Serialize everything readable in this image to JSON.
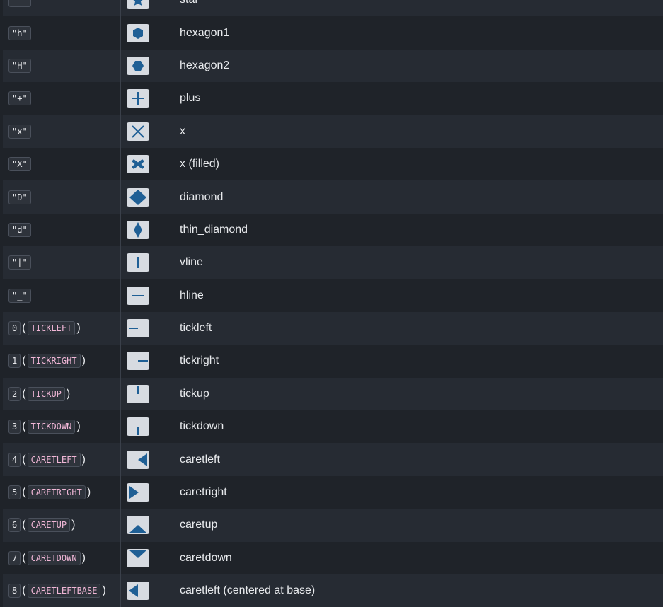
{
  "colors": {
    "marker": "#1f5f95",
    "swatch_bg": "#d7dbe1"
  },
  "rows": [
    {
      "code": "",
      "marker_icon": "star-icon",
      "description": "star"
    },
    {
      "code": "\"h\"",
      "marker_icon": "hexagon1-icon",
      "description": "hexagon1"
    },
    {
      "code": "\"H\"",
      "marker_icon": "hexagon2-icon",
      "description": "hexagon2"
    },
    {
      "code": "\"+\"",
      "marker_icon": "plus-icon",
      "description": "plus"
    },
    {
      "code": "\"x\"",
      "marker_icon": "x-icon",
      "description": "x"
    },
    {
      "code": "\"X\"",
      "marker_icon": "x-filled-icon",
      "description": "x (filled)"
    },
    {
      "code": "\"D\"",
      "marker_icon": "diamond-icon",
      "description": "diamond"
    },
    {
      "code": "\"d\"",
      "marker_icon": "thin-diamond-icon",
      "description": "thin_diamond"
    },
    {
      "code": "\"|\"",
      "marker_icon": "vline-icon",
      "description": "vline"
    },
    {
      "code": "\"_\"",
      "marker_icon": "hline-icon",
      "description": "hline"
    },
    {
      "code": "0",
      "constant": "TICKLEFT",
      "marker_icon": "tickleft-icon",
      "description": "tickleft"
    },
    {
      "code": "1",
      "constant": "TICKRIGHT",
      "marker_icon": "tickright-icon",
      "description": "tickright"
    },
    {
      "code": "2",
      "constant": "TICKUP",
      "marker_icon": "tickup-icon",
      "description": "tickup"
    },
    {
      "code": "3",
      "constant": "TICKDOWN",
      "marker_icon": "tickdown-icon",
      "description": "tickdown"
    },
    {
      "code": "4",
      "constant": "CARETLEFT",
      "marker_icon": "caretleft-icon",
      "description": "caretleft"
    },
    {
      "code": "5",
      "constant": "CARETRIGHT",
      "marker_icon": "caretright-icon",
      "description": "caretright"
    },
    {
      "code": "6",
      "constant": "CARETUP",
      "marker_icon": "caretup-icon",
      "description": "caretup"
    },
    {
      "code": "7",
      "constant": "CARETDOWN",
      "marker_icon": "caretdown-icon",
      "description": "caretdown"
    },
    {
      "code": "8",
      "constant": "CARETLEFTBASE",
      "marker_icon": "caretleftbase-icon",
      "description": "caretleft (centered at base)"
    }
  ]
}
